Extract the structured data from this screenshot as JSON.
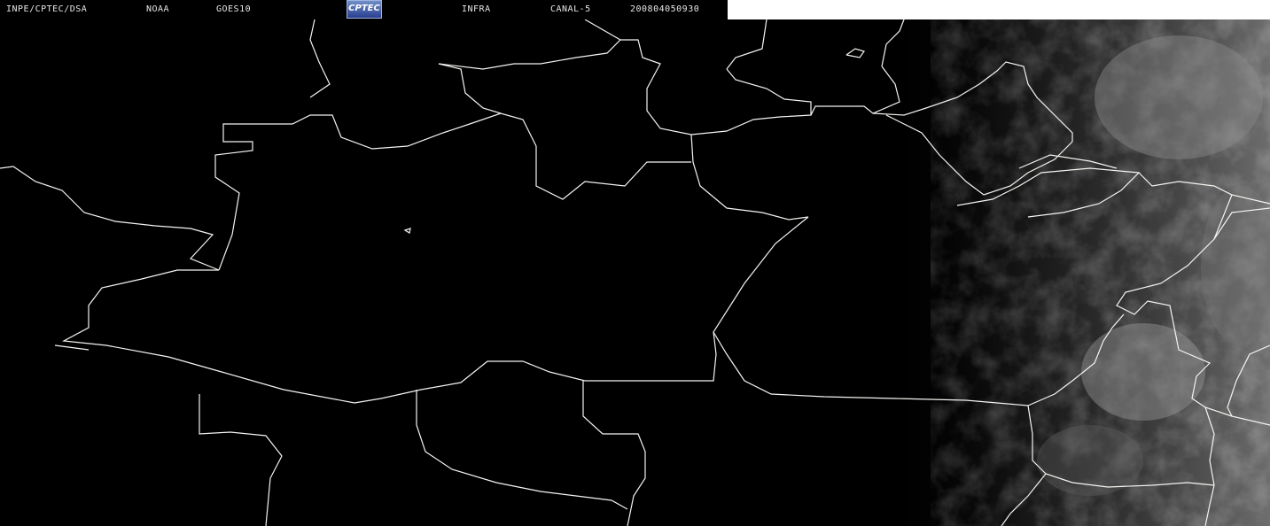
{
  "header": {
    "institution": "INPE/CPTEC/DSA",
    "agency": "NOAA",
    "satellite": "GOES10",
    "logo_text": "CPTEC",
    "product": "INFRA",
    "channel": "CANAL-5",
    "timestamp": "200804050930"
  },
  "colors": {
    "background": "#000000",
    "borders": "#f4f4f0",
    "clouds": "#8a8a8a",
    "header_text": "#e6e6e6",
    "logo": "#3a55a8"
  }
}
